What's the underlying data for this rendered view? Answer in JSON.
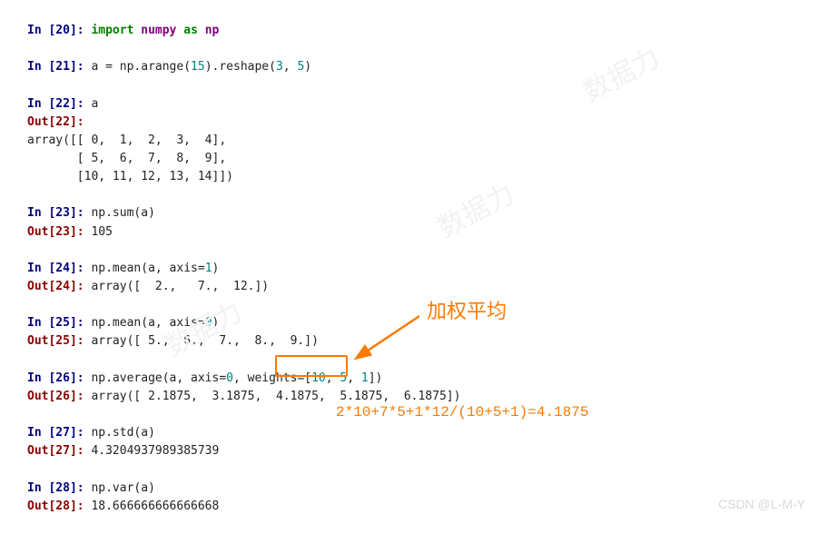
{
  "code": {
    "in20": "In [20]: ",
    "in20_kw_import": "import",
    "in20_sp1": " ",
    "in20_mod": "numpy",
    "in20_sp2": " ",
    "in20_kw_as": "as",
    "in20_sp3": " ",
    "in20_alias": "np",
    "in21": "In [21]: ",
    "in21_code_a": "a = np.arange(",
    "in21_num1": "15",
    "in21_code_b": ").reshape(",
    "in21_num2": "3",
    "in21_code_c": ", ",
    "in21_num3": "5",
    "in21_code_d": ")",
    "in22": "In [22]: ",
    "in22_code": "a",
    "out22": "Out[22]:",
    "out22_l1": "array([[ 0,  1,  2,  3,  4],",
    "out22_l2": "       [ 5,  6,  7,  8,  9],",
    "out22_l3": "       [10, 11, 12, 13, 14]])",
    "in23": "In [23]: ",
    "in23_code": "np.sum(a)",
    "out23": "Out[23]: ",
    "out23_val": "105",
    "in24": "In [24]: ",
    "in24_code_a": "np.mean(a, axis=",
    "in24_num": "1",
    "in24_code_b": ")",
    "out24": "Out[24]: ",
    "out24_val": "array([  2.,   7.,  12.])",
    "in25": "In [25]: ",
    "in25_code_a": "np.mean(a, axis=",
    "in25_num": "0",
    "in25_code_b": ")",
    "out25": "Out[25]: ",
    "out25_val": "array([ 5.,  6.,  7.,  8.,  9.])",
    "in26": "In [26]: ",
    "in26_code_a": "np.average(a, axis=",
    "in26_num0": "0",
    "in26_code_b": ", weights=[",
    "in26_num1": "10",
    "in26_code_c": ", ",
    "in26_num2": "5",
    "in26_code_d": ", ",
    "in26_num3": "1",
    "in26_code_e": "])",
    "out26": "Out[26]: ",
    "out26_val": "array([ 2.1875,  3.1875,  4.1875,  5.1875,  6.1875])",
    "in27": "In [27]: ",
    "in27_code": "np.std(a)",
    "out27": "Out[27]: ",
    "out27_val": "4.3204937989385739",
    "in28": "In [28]: ",
    "in28_code": "np.var(a)",
    "out28": "Out[28]: ",
    "out28_val": "18.666666666666668"
  },
  "annotations": {
    "title": "加权平均",
    "formula": "2*10+7*5+1*12/(10+5+1)=4.1875",
    "highlight_target": "4.1875"
  },
  "watermark": {
    "bottom": "CSDN @L-M-Y",
    "diag": "数据力"
  }
}
